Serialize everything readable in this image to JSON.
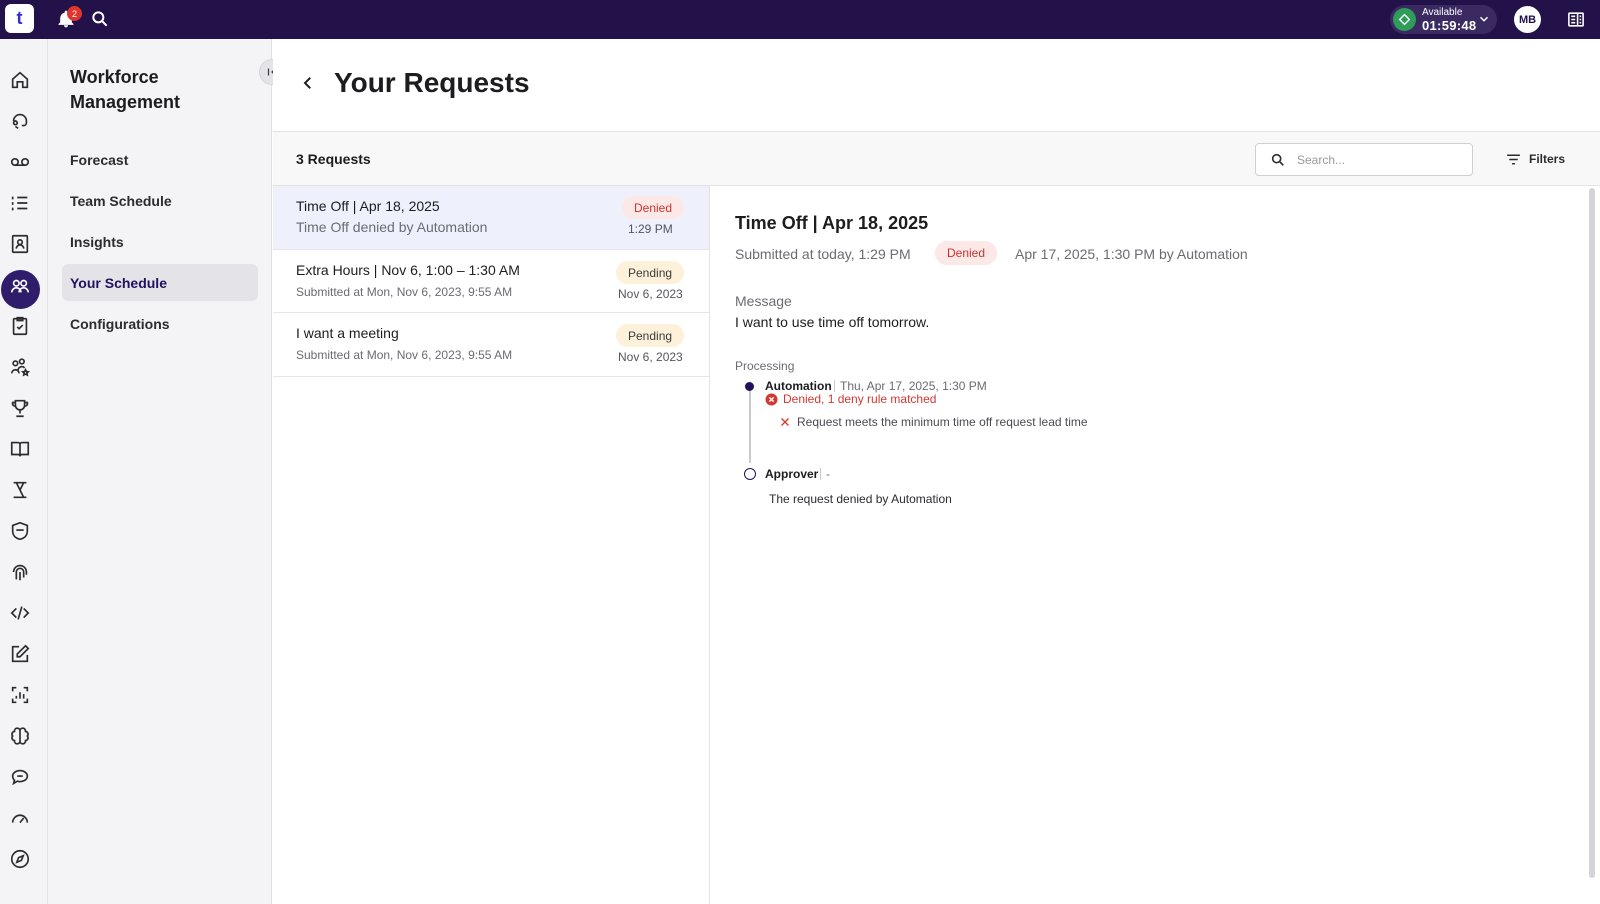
{
  "topbar": {
    "logo_letter": "t",
    "notification_count": "2",
    "status": {
      "label": "Available",
      "timer": "01:59:48",
      "color": "#2e9d5a"
    },
    "avatar_initials": "MB",
    "brand_color": "#23114a"
  },
  "rail": {
    "icons": [
      "home-icon",
      "agent-assist-icon",
      "voicemail-icon",
      "list-icon",
      "contacts-icon",
      "workforce-icon",
      "clipboard-check-icon",
      "team-star-icon",
      "trophy-icon",
      "book-icon",
      "routing-icon",
      "shield-icon",
      "fingerprint-icon",
      "code-icon",
      "edit-icon",
      "analytics-icon",
      "brain-icon",
      "chat-icon",
      "dashboard-gauge-icon",
      "compass-icon"
    ],
    "active": "workforce-icon"
  },
  "sidebar": {
    "title": "Workforce Management",
    "items": [
      {
        "label": "Forecast"
      },
      {
        "label": "Team Schedule"
      },
      {
        "label": "Insights"
      },
      {
        "label": "Your Schedule",
        "active": true
      },
      {
        "label": "Configurations"
      }
    ]
  },
  "header": {
    "title": "Your Requests"
  },
  "toolbar": {
    "count_label": "3 Requests",
    "search_placeholder": "Search...",
    "filters_label": "Filters"
  },
  "requests": [
    {
      "title": "Time Off | Apr 18, 2025",
      "subtitle": "Time Off denied by Automation",
      "status": "Denied",
      "date": "1:29 PM",
      "selected": true
    },
    {
      "title": "Extra Hours | Nov 6, 1:00 – 1:30 AM",
      "subtitle": "Submitted at Mon, Nov 6, 2023, 9:55 AM",
      "status": "Pending",
      "date": "Nov 6, 2023"
    },
    {
      "title": "I want a meeting",
      "subtitle": "Submitted at Mon, Nov 6, 2023, 9:55 AM",
      "status": "Pending",
      "date": "Nov 6, 2023"
    }
  ],
  "detail": {
    "title": "Time Off | Apr 18, 2025",
    "submitted": "Submitted at today, 1:29 PM",
    "status": "Denied",
    "decided": "Apr 17, 2025, 1:30 PM by Automation",
    "message_label": "Message",
    "message": "I want to use time off tomorrow.",
    "processing_label": "Processing",
    "steps": [
      {
        "name": "Automation",
        "meta": "Thu, Apr 17, 2025, 1:30 PM",
        "result": "Denied, 1 deny rule matched",
        "rule": "Request meets the minimum time off request lead time"
      },
      {
        "name": "Approver",
        "meta": "-",
        "note": "The request denied by Automation"
      }
    ]
  }
}
